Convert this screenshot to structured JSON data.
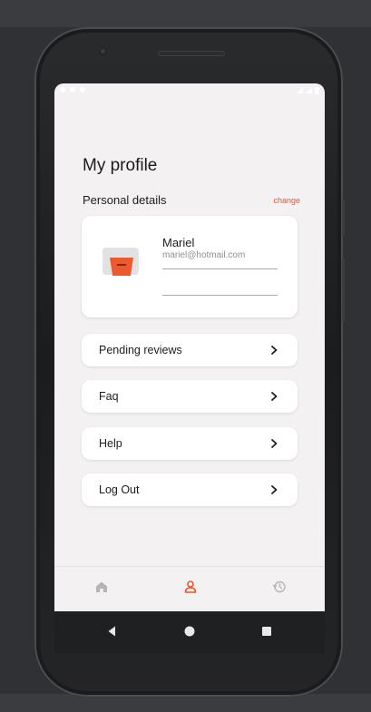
{
  "screen": {
    "title": "My profile"
  },
  "personal_details": {
    "label": "Personal details",
    "change_label": "change"
  },
  "profile": {
    "name": "Mariel",
    "email": "mariel@hotmail.com"
  },
  "menu": {
    "items": [
      {
        "label": "Pending reviews",
        "icon": "chevron-right-icon"
      },
      {
        "label": "Faq",
        "icon": "chevron-right-icon"
      },
      {
        "label": "Help",
        "icon": "chevron-right-icon"
      },
      {
        "label": "Log Out",
        "icon": "chevron-right-icon"
      }
    ]
  },
  "bottom_nav": {
    "items": [
      {
        "icon": "home-icon",
        "active": false
      },
      {
        "icon": "profile-icon",
        "active": true
      },
      {
        "icon": "history-icon",
        "active": false
      }
    ]
  },
  "system_nav": {
    "items": [
      "back-icon",
      "home-circle-icon",
      "recents-icon"
    ]
  },
  "colors": {
    "accent": "#e8552b",
    "screen_bg": "#f3f1f1",
    "card_bg": "#ffffff",
    "inactive_icon": "#b5b5b5"
  }
}
